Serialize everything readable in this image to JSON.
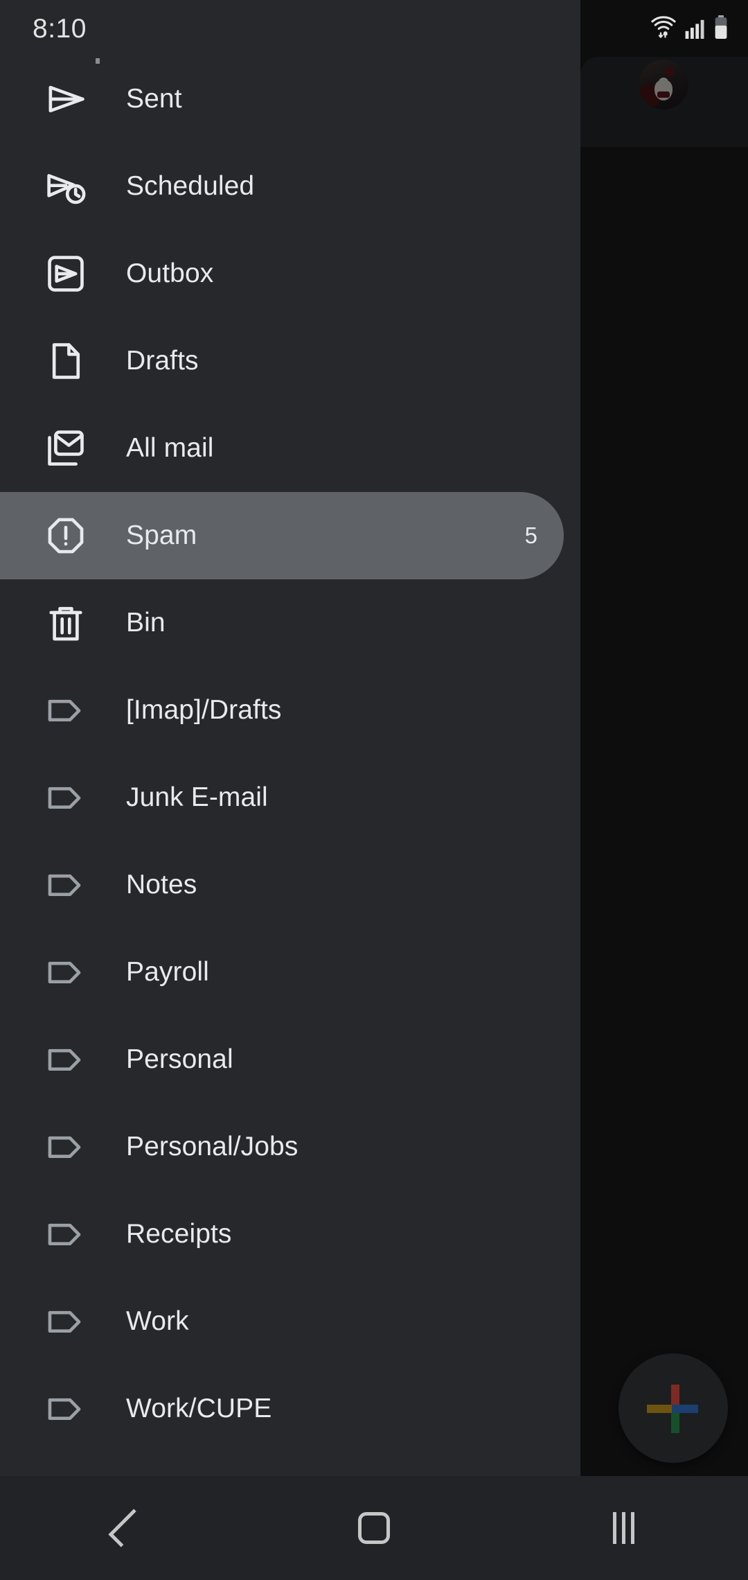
{
  "status_bar": {
    "time": "8:10",
    "icons": [
      "wifi-icon",
      "cellular-signal-icon",
      "battery-icon"
    ]
  },
  "drawer": {
    "items": [
      {
        "label": "Sent",
        "icon": "sent-icon",
        "count": "",
        "selected": false
      },
      {
        "label": "Scheduled",
        "icon": "scheduled-icon",
        "count": "",
        "selected": false
      },
      {
        "label": "Outbox",
        "icon": "outbox-icon",
        "count": "",
        "selected": false
      },
      {
        "label": "Drafts",
        "icon": "drafts-icon",
        "count": "",
        "selected": false
      },
      {
        "label": "All mail",
        "icon": "all-mail-icon",
        "count": "",
        "selected": false
      },
      {
        "label": "Spam",
        "icon": "spam-icon",
        "count": "5",
        "selected": true
      },
      {
        "label": "Bin",
        "icon": "bin-icon",
        "count": "",
        "selected": false
      },
      {
        "label": "[Imap]/Drafts",
        "icon": "label-icon",
        "count": "",
        "selected": false
      },
      {
        "label": "Junk E-mail",
        "icon": "label-icon",
        "count": "",
        "selected": false
      },
      {
        "label": "Notes",
        "icon": "label-icon",
        "count": "",
        "selected": false
      },
      {
        "label": "Payroll",
        "icon": "label-icon",
        "count": "",
        "selected": false
      },
      {
        "label": "Personal",
        "icon": "label-icon",
        "count": "",
        "selected": false
      },
      {
        "label": "Personal/Jobs",
        "icon": "label-icon",
        "count": "",
        "selected": false
      },
      {
        "label": "Receipts",
        "icon": "label-icon",
        "count": "",
        "selected": false
      },
      {
        "label": "Work",
        "icon": "label-icon",
        "count": "",
        "selected": false
      },
      {
        "label": "Work/CUPE",
        "icon": "label-icon",
        "count": "",
        "selected": false
      }
    ],
    "selected_highlight_color": "#5f6368",
    "background_color": "#26282b"
  },
  "app_background": {
    "avatar": "profile-avatar",
    "fab": "compose-fab",
    "fab_icon": "google-plus-icon",
    "scrim_color": "#0d0d0e"
  },
  "navigation_bar": {
    "buttons": [
      "back-button",
      "home-button",
      "recents-button"
    ]
  }
}
